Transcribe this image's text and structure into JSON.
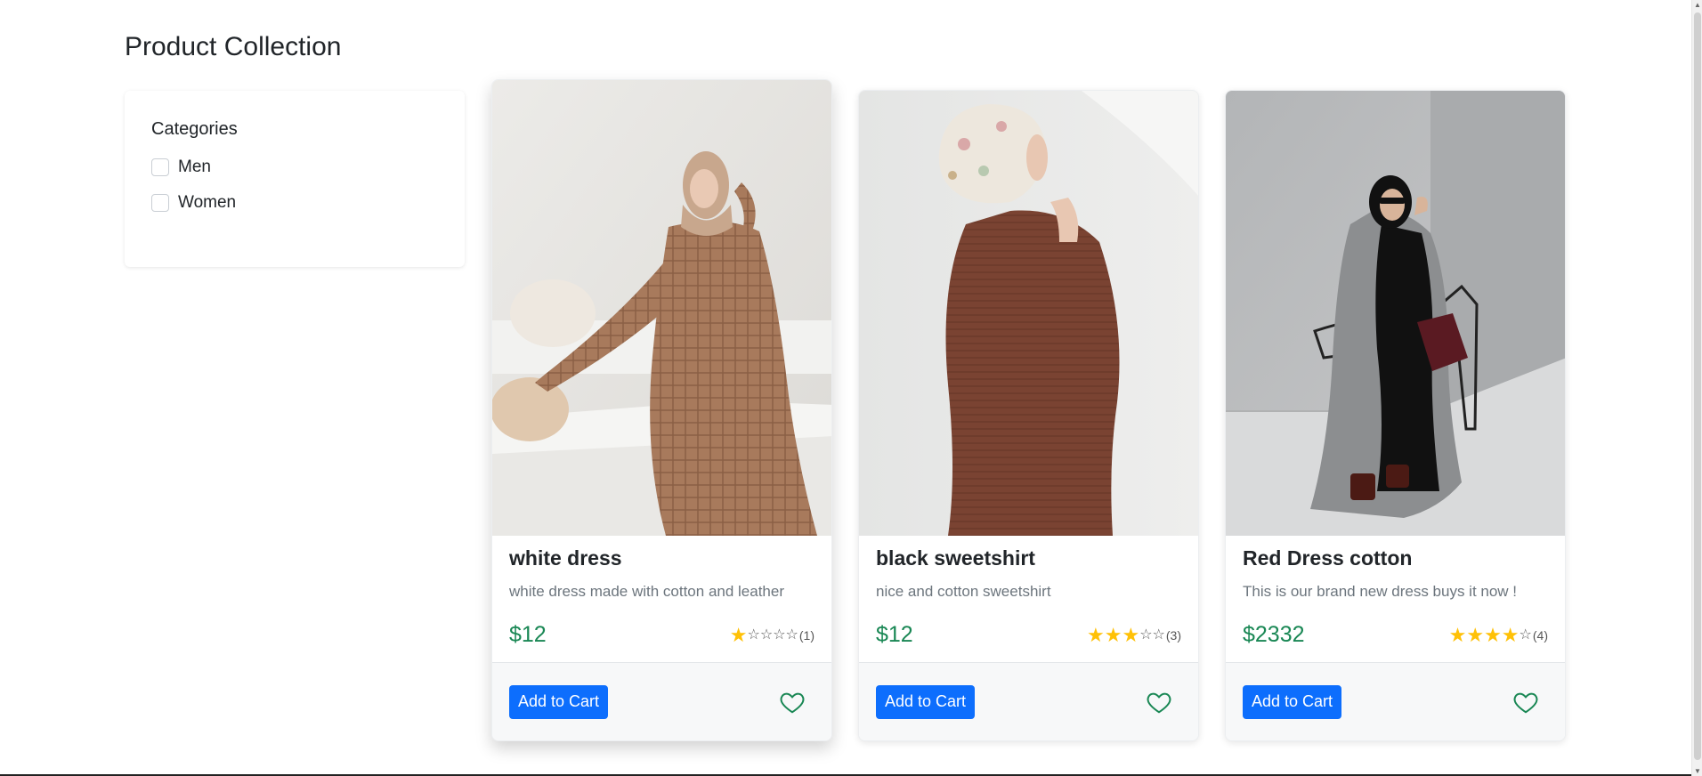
{
  "page": {
    "title": "Product Collection"
  },
  "filters": {
    "heading": "Categories",
    "options": [
      {
        "label": "Men",
        "checked": false
      },
      {
        "label": "Women",
        "checked": false
      }
    ]
  },
  "products": [
    {
      "name": "white dress",
      "description": "white dress made with cotton and leather",
      "price": "$12",
      "rating": 1,
      "rating_count": "(1)",
      "cart_label": "Add to Cart",
      "image_icon": "woman-in-plaid-dress-photo"
    },
    {
      "name": "black sweetshirt",
      "description": "nice and cotton sweetshirt",
      "price": "$12",
      "rating": 3,
      "rating_count": "(3)",
      "cart_label": "Add to Cart",
      "image_icon": "woman-in-brown-sweater-photo"
    },
    {
      "name": "Red Dress cotton",
      "description": "This is our brand new dress buys it now !",
      "price": "$2332",
      "rating": 4,
      "rating_count": "(4)",
      "cart_label": "Add to Cart",
      "image_icon": "woman-in-gray-coat-photo"
    }
  ],
  "colors": {
    "accent": "#0d6efd",
    "price": "#198754",
    "star": "#ffc107",
    "heart": "#198754"
  }
}
